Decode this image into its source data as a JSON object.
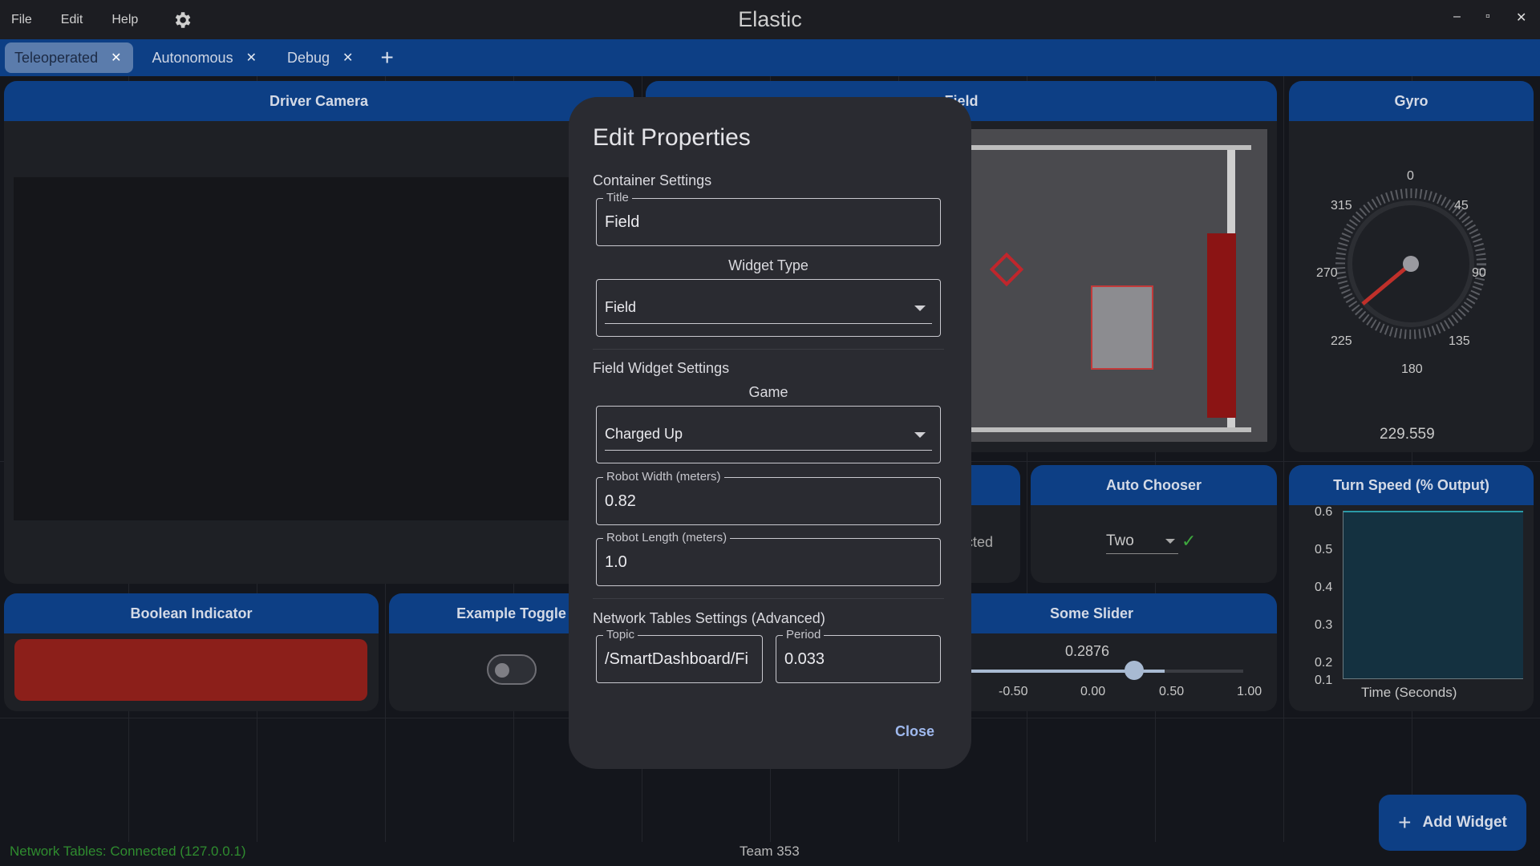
{
  "app": {
    "title": "Elastic"
  },
  "menu": [
    "File",
    "Edit",
    "Help"
  ],
  "window_controls": {
    "minimize": "–",
    "maximize": "▫",
    "close": "✕"
  },
  "tabs": [
    {
      "label": "Teleoperated",
      "active": true
    },
    {
      "label": "Autonomous",
      "active": false
    },
    {
      "label": "Debug",
      "active": false
    }
  ],
  "tab_add": "+",
  "tab_close": "✕",
  "widgets": {
    "driver_camera": {
      "title": "Driver Camera"
    },
    "field": {
      "title": "Field"
    },
    "gyro": {
      "title": "Gyro",
      "value": "229.559",
      "ticks": [
        "0",
        "45",
        "90",
        "135",
        "180",
        "225",
        "270",
        "315"
      ]
    },
    "auto_chooser": {
      "title": "Auto Chooser",
      "selected": "Two",
      "check": "✓"
    },
    "turn_speed": {
      "title": "Turn Speed (% Output)",
      "yticks": [
        "0.6",
        "0.5",
        "0.4",
        "0.3",
        "0.2",
        "0.1"
      ],
      "xlabel": "Time (Seconds)"
    },
    "boolean_indicator": {
      "title": "Boolean Indicator",
      "color": "#8c1f1a"
    },
    "example_toggle": {
      "title": "Example Toggle"
    },
    "some_slider": {
      "title": "Some Slider",
      "value": "0.2876",
      "ticks": [
        "-0.50",
        "0.00",
        "0.50",
        "1.00"
      ]
    },
    "partial_text": "cted"
  },
  "modal": {
    "title": "Edit Properties",
    "container_settings": "Container Settings",
    "title_field": {
      "label": "Title",
      "value": "Field"
    },
    "widget_type": {
      "label": "Widget Type",
      "value": "Field"
    },
    "field_widget_settings": "Field Widget Settings",
    "game": {
      "label": "Game",
      "value": "Charged Up"
    },
    "robot_width": {
      "label": "Robot Width (meters)",
      "value": "0.82"
    },
    "robot_length": {
      "label": "Robot Length (meters)",
      "value": "1.0"
    },
    "nt_settings": "Network Tables Settings (Advanced)",
    "topic": {
      "label": "Topic",
      "value": "/SmartDashboard/Fi"
    },
    "period": {
      "label": "Period",
      "value": "0.033"
    },
    "close": "Close"
  },
  "status": {
    "left": "Network Tables: Connected (127.0.0.1)",
    "middle": "Team 353"
  },
  "add_widget": {
    "label": "Add Widget",
    "plus": "+"
  }
}
